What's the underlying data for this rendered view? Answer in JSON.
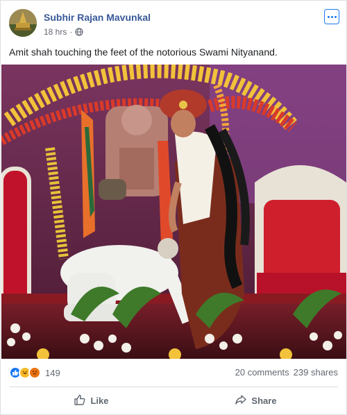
{
  "post": {
    "author": "Subhir Rajan Mavunkal",
    "timestamp": "18 hrs",
    "separator": "·",
    "privacy_icon": "globe-icon",
    "text": "Amit shah touching the feet of the notorious Swami Nityanand."
  },
  "reactions": {
    "icons": [
      "like-icon",
      "haha-icon",
      "angry-icon"
    ],
    "count": "149",
    "comments": "20 comments",
    "shares": "239 shares"
  },
  "actions": {
    "like_label": "Like",
    "share_label": "Share"
  },
  "colors": {
    "link": "#385898",
    "facebook_blue": "#1877f2",
    "muted_text": "#616770"
  }
}
